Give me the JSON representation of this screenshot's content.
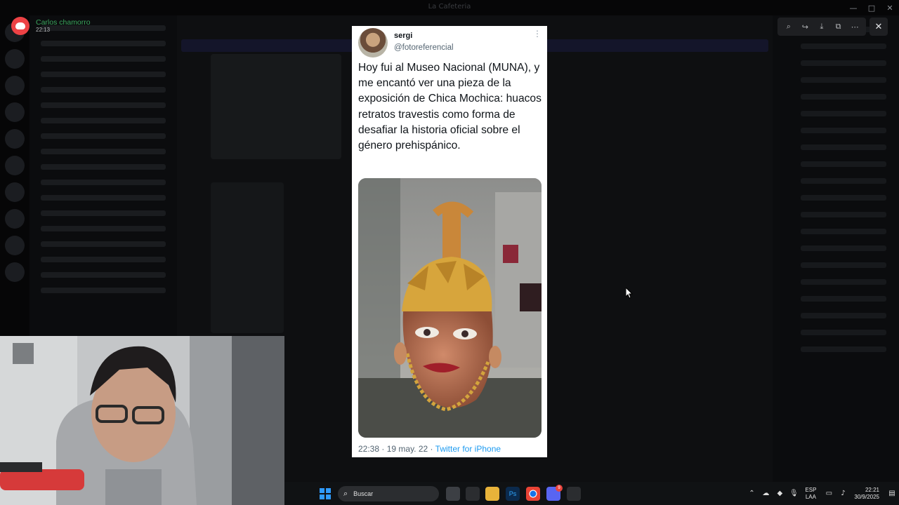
{
  "window": {
    "title": "La Cafeteria",
    "controls": [
      "—",
      "□",
      "✕"
    ]
  },
  "notification": {
    "name": "Carlos chamorro",
    "time": "22:13",
    "accent": "#3ba55d"
  },
  "viewer": {
    "tools": [
      {
        "icon": "zoom-in-icon",
        "glyph": "⌕"
      },
      {
        "icon": "forward-icon",
        "glyph": "↪"
      },
      {
        "icon": "download-icon",
        "glyph": "⤓"
      },
      {
        "icon": "open-external-icon",
        "glyph": "⧉"
      },
      {
        "icon": "more-icon",
        "glyph": "⋯"
      }
    ],
    "close_glyph": "✕"
  },
  "tweet": {
    "name": "sergi",
    "handle": "@fotoreferencial",
    "more_glyph": "⋮",
    "text": "Hoy fui al Museo Nacional (MUNA), y me encantó ver una pieza de la exposición de Chica Mochica: huacos retratos travestis como forma de desafiar la historia oficial sobre el género prehispánico.",
    "time": "22:38",
    "date": "19 may. 22",
    "source": "Twitter for iPhone"
  },
  "taskbar": {
    "search_placeholder": "Buscar",
    "photoshop_label": "Ps",
    "discord_badge": "9",
    "lang_line1": "ESP",
    "lang_line2": "LAA",
    "clock_time": "22:21",
    "clock_date": "30/9/2025"
  }
}
